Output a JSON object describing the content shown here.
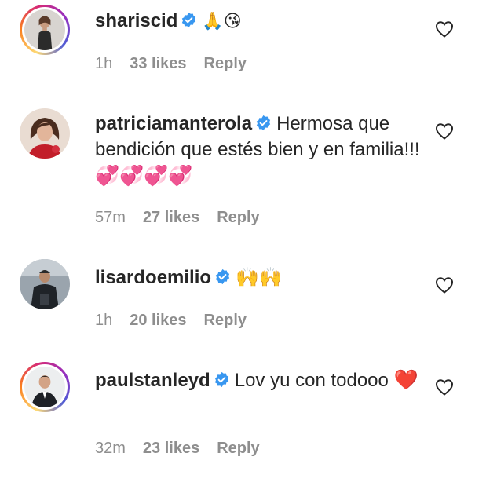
{
  "comments": [
    {
      "username": "shariscid",
      "text": "",
      "emojis": "🙏😘",
      "time": "1h",
      "likes": "33 likes",
      "reply": "Reply"
    },
    {
      "username": "patriciamanterola",
      "text": "Hermosa que bendición que estés bien y en familia!!!",
      "emojis": "💞💞💞💞",
      "time": "57m",
      "likes": "27 likes",
      "reply": "Reply"
    },
    {
      "username": "lisardoemilio",
      "text": "",
      "emojis": "🙌🙌",
      "time": "1h",
      "likes": "20 likes",
      "reply": "Reply"
    },
    {
      "username": "paulstanleyd",
      "text": "Lov yu con todooo",
      "emojis": "❤️",
      "time": "32m",
      "likes": "23 likes",
      "reply": "Reply"
    }
  ],
  "icons": {
    "verified": "verified-badge-icon",
    "like": "heart-outline-icon"
  },
  "colors": {
    "verified_blue": "#3897f0",
    "meta_gray": "#8e8e8e",
    "text_dark": "#262626",
    "heart_red": "#e0245e"
  }
}
